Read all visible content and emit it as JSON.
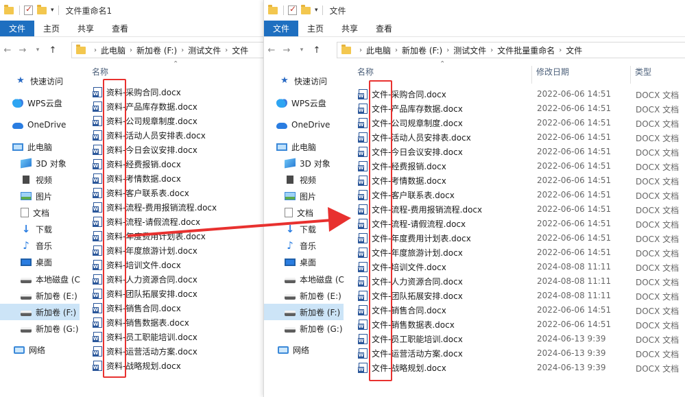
{
  "left_window": {
    "title": "文件重命名1",
    "ribbon_tabs": [
      "文件",
      "主页",
      "共享",
      "查看"
    ],
    "breadcrumb": [
      "此电脑",
      "新加卷 (F:)",
      "测试文件",
      "文件"
    ],
    "header_name": "名称",
    "files": [
      "资料-采购合同.docx",
      "资料-产品库存数据.docx",
      "资料-公司规章制度.docx",
      "资料-活动人员安排表.docx",
      "资料-今日会议安排.docx",
      "资料-经费报销.docx",
      "资料-考情数据.docx",
      "资料-客户联系表.docx",
      "资料-流程-费用报销流程.docx",
      "资料-流程-请假流程.docx",
      "资料-年度费用计划表.docx",
      "资料-年度旅游计划.docx",
      "资料-培训文件.docx",
      "资料-人力资源合同.docx",
      "资料-团队拓展安排.docx",
      "资料-销售合同.docx",
      "资料-销售数据表.docx",
      "资料-员工职能培训.docx",
      "资料-运营活动方案.docx",
      "资料-战略规划.docx"
    ]
  },
  "right_window": {
    "title": "文件",
    "ribbon_tabs": [
      "文件",
      "主页",
      "共享",
      "查看"
    ],
    "breadcrumb": [
      "此电脑",
      "新加卷 (F:)",
      "测试文件",
      "文件批量重命名",
      "文件"
    ],
    "header_name": "名称",
    "header_date": "修改日期",
    "header_type": "类型",
    "files": [
      {
        "name": "文件-采购合同.docx",
        "date": "2022-06-06 14:51",
        "type": "DOCX 文档"
      },
      {
        "name": "文件-产品库存数据.docx",
        "date": "2022-06-06 14:51",
        "type": "DOCX 文档"
      },
      {
        "name": "文件-公司规章制度.docx",
        "date": "2022-06-06 14:51",
        "type": "DOCX 文档"
      },
      {
        "name": "文件-活动人员安排表.docx",
        "date": "2022-06-06 14:51",
        "type": "DOCX 文档"
      },
      {
        "name": "文件-今日会议安排.docx",
        "date": "2022-06-06 14:51",
        "type": "DOCX 文档"
      },
      {
        "name": "文件-经费报销.docx",
        "date": "2022-06-06 14:51",
        "type": "DOCX 文档"
      },
      {
        "name": "文件-考情数据.docx",
        "date": "2022-06-06 14:51",
        "type": "DOCX 文档"
      },
      {
        "name": "文件-客户联系表.docx",
        "date": "2022-06-06 14:51",
        "type": "DOCX 文档"
      },
      {
        "name": "文件-流程-费用报销流程.docx",
        "date": "2022-06-06 14:51",
        "type": "DOCX 文档"
      },
      {
        "name": "文件-流程-请假流程.docx",
        "date": "2022-06-06 14:51",
        "type": "DOCX 文档"
      },
      {
        "name": "文件-年度费用计划表.docx",
        "date": "2022-06-06 14:51",
        "type": "DOCX 文档"
      },
      {
        "name": "文件-年度旅游计划.docx",
        "date": "2022-06-06 14:51",
        "type": "DOCX 文档"
      },
      {
        "name": "文件-培训文件.docx",
        "date": "2024-08-08 11:11",
        "type": "DOCX 文档"
      },
      {
        "name": "文件-人力资源合同.docx",
        "date": "2024-08-08 11:11",
        "type": "DOCX 文档"
      },
      {
        "name": "文件-团队拓展安排.docx",
        "date": "2024-08-08 11:11",
        "type": "DOCX 文档"
      },
      {
        "name": "文件-销售合同.docx",
        "date": "2022-06-06 14:51",
        "type": "DOCX 文档"
      },
      {
        "name": "文件-销售数据表.docx",
        "date": "2022-06-06 14:51",
        "type": "DOCX 文档"
      },
      {
        "name": "文件-员工职能培训.docx",
        "date": "2024-06-13 9:39",
        "type": "DOCX 文档"
      },
      {
        "name": "文件-运营活动方案.docx",
        "date": "2024-06-13 9:39",
        "type": "DOCX 文档"
      },
      {
        "name": "文件-战略规划.docx",
        "date": "2024-06-13 9:39",
        "type": "DOCX 文档"
      }
    ]
  },
  "nav_pane": [
    {
      "label": "快速访问",
      "icon": "star-icon"
    },
    {
      "label": "WPS云盘",
      "icon": "wps-cloud-icon"
    },
    {
      "label": "OneDrive",
      "icon": "onedrive-icon"
    },
    {
      "label": "此电脑",
      "icon": "this-pc-icon"
    },
    {
      "label": "3D 对象",
      "icon": "3d-objects-icon"
    },
    {
      "label": "视频",
      "icon": "video-icon"
    },
    {
      "label": "图片",
      "icon": "pictures-icon"
    },
    {
      "label": "文档",
      "icon": "documents-icon"
    },
    {
      "label": "下载",
      "icon": "download-icon"
    },
    {
      "label": "音乐",
      "icon": "music-icon"
    },
    {
      "label": "桌面",
      "icon": "desktop-icon"
    },
    {
      "label": "本地磁盘 (C",
      "icon": "system-drive-icon"
    },
    {
      "label": "新加卷 (E:)",
      "icon": "drive-icon"
    },
    {
      "label": "新加卷 (F:)",
      "icon": "drive-icon",
      "selected": true
    },
    {
      "label": "新加卷 (G:)",
      "icon": "drive-icon"
    },
    {
      "label": "网络",
      "icon": "network-icon"
    }
  ],
  "colors": {
    "accent": "#1e6fc0",
    "highlight": "#e8312f",
    "selected_bg": "#cce4f7"
  }
}
